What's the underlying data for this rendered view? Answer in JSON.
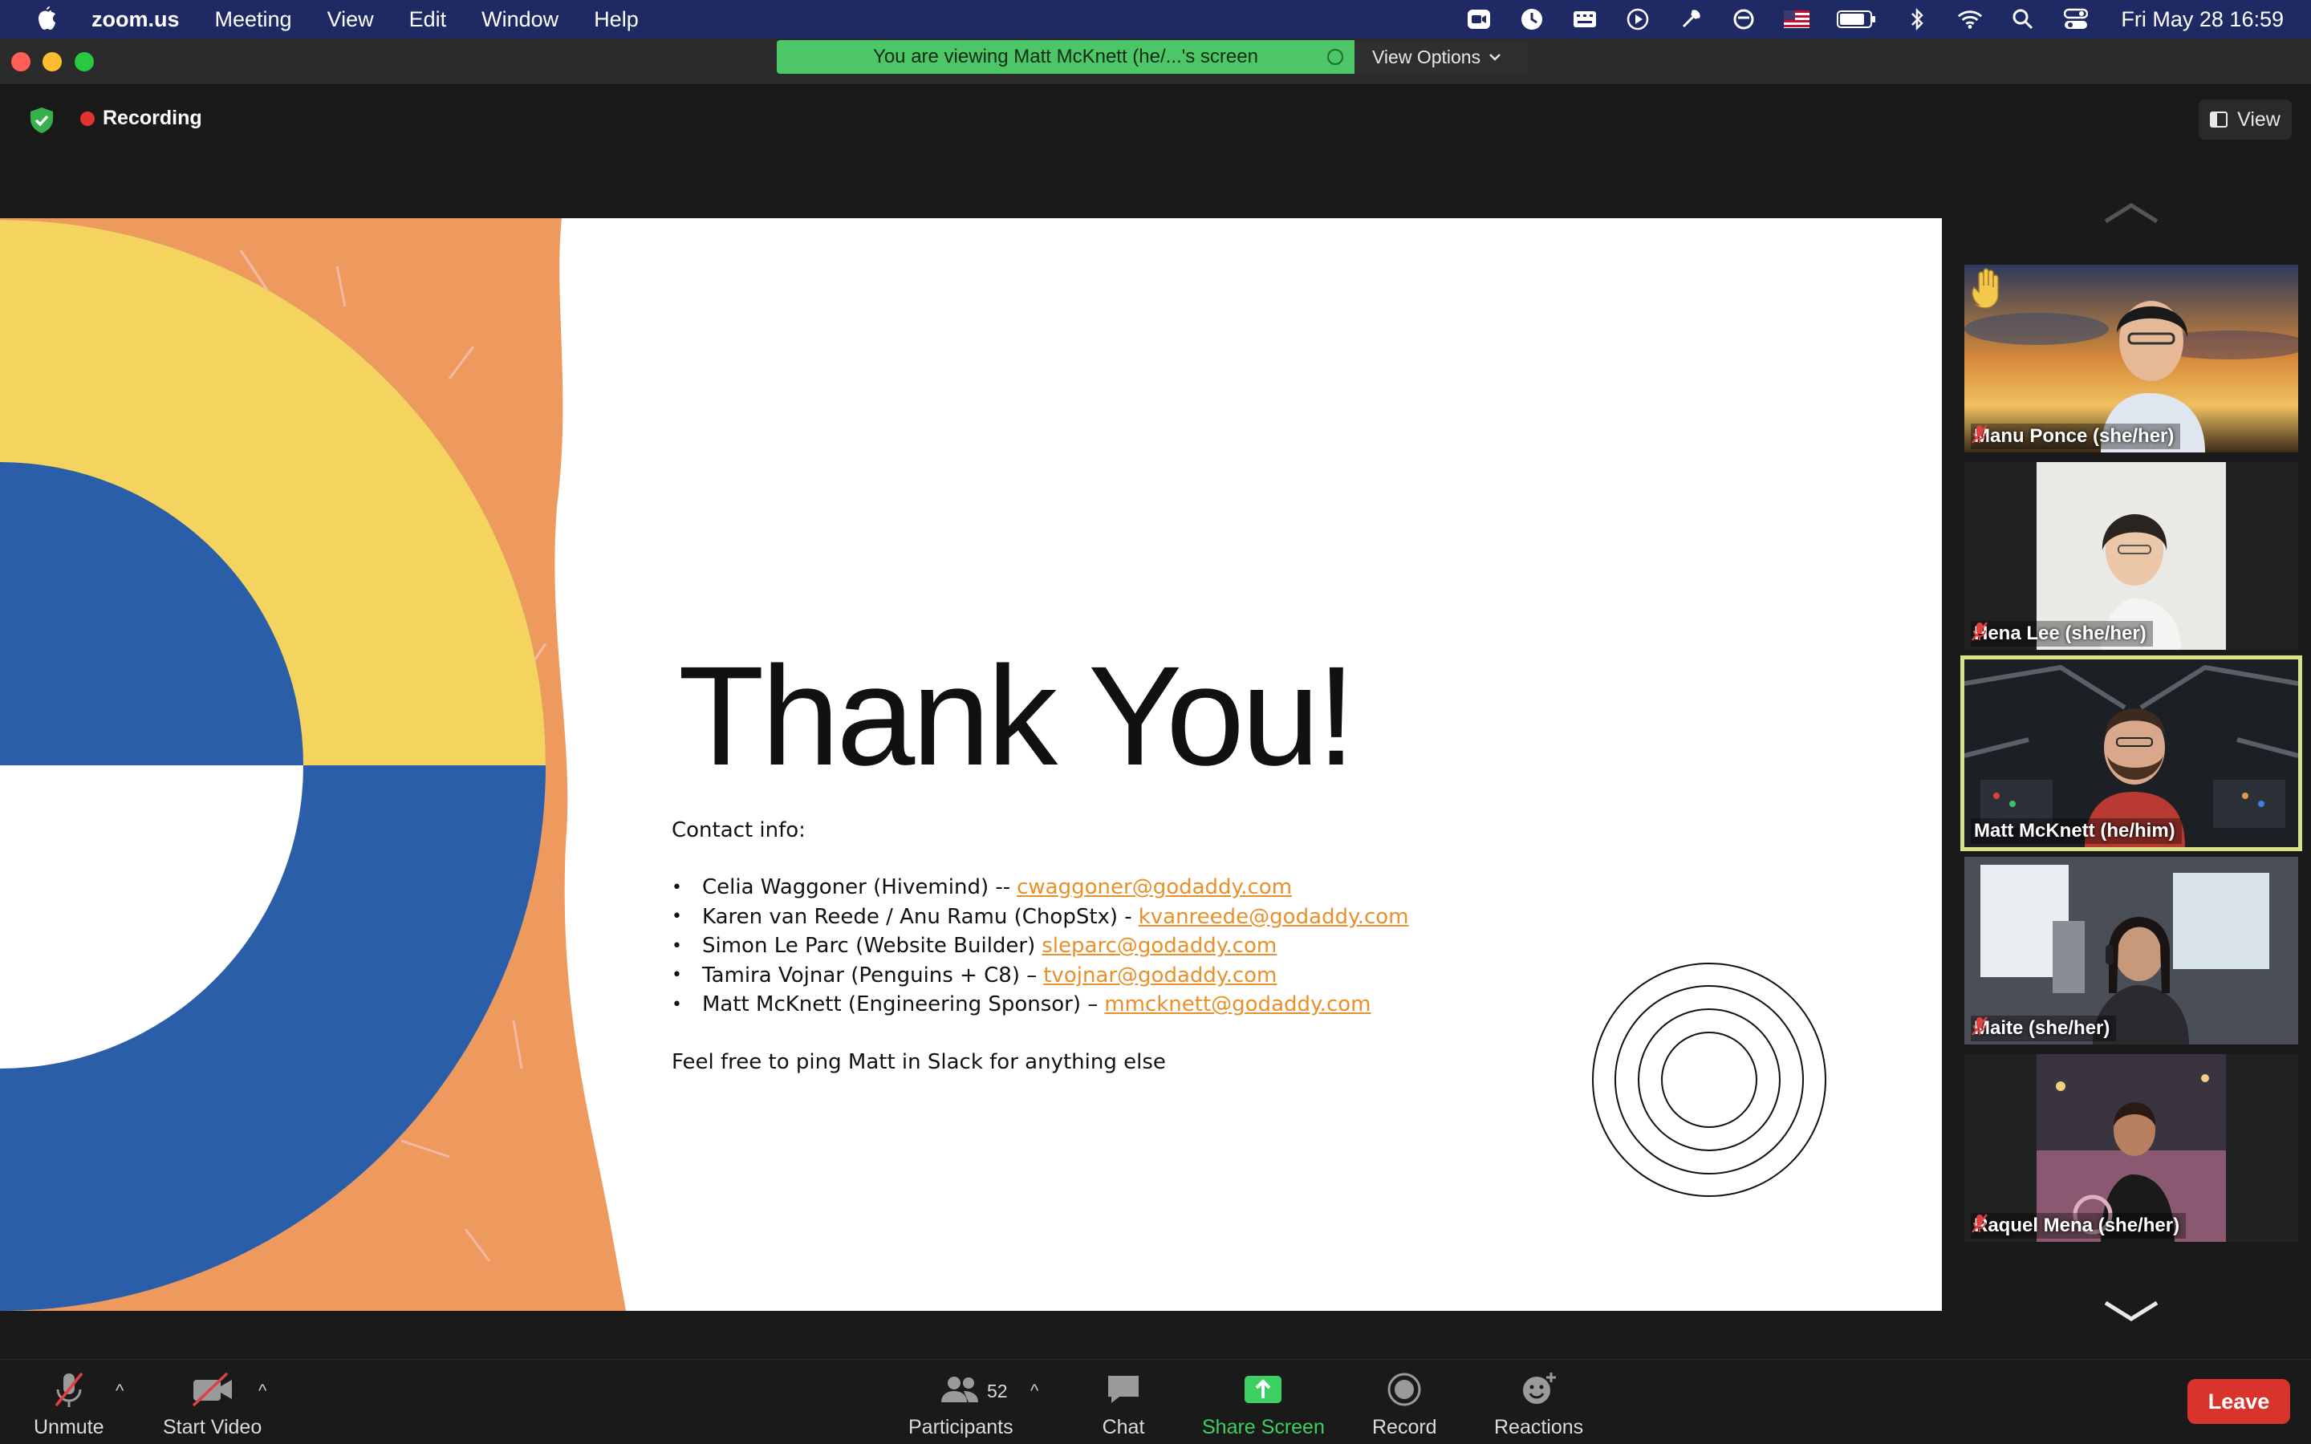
{
  "menubar": {
    "app": "zoom.us",
    "items": [
      "Meeting",
      "View",
      "Edit",
      "Window",
      "Help"
    ],
    "clock": "Fri May 28  16:59",
    "status_icons": [
      "zoom-icon",
      "clock-icon",
      "keyboard-icon",
      "play-icon",
      "tool-icon",
      "sync-icon",
      "flag-icon",
      "battery-icon",
      "bluetooth-icon",
      "wifi-icon",
      "search-icon",
      "control-center-icon"
    ]
  },
  "banner": {
    "viewing": "You are viewing Matt McKnett (he/...'s screen",
    "view_options": "View Options"
  },
  "meeting": {
    "recording": "Recording",
    "view_button": "View"
  },
  "slide": {
    "title": "Thank You!",
    "contact_label": "Contact info:",
    "contacts": [
      {
        "text": "Celia Waggoner (Hivemind) --",
        "email": "cwaggoner@godaddy.com"
      },
      {
        "text": "Karen van Reede / Anu Ramu (ChopStx) -",
        "email": "kvanreede@godaddy.com"
      },
      {
        "text": "Simon Le Parc (Website Builder)",
        "email": "sleparc@godaddy.com"
      },
      {
        "text": "Tamira Vojnar (Penguins + C8) –",
        "email": "tvojnar@godaddy.com"
      },
      {
        "text": "Matt McKnett (Engineering Sponsor) –",
        "email": "mmcknett@godaddy.com"
      }
    ],
    "footer": "Feel free to ping Matt in Slack for anything else",
    "colors": {
      "orange": "#ee9a5f",
      "yellow": "#f4d35e",
      "blue": "#2b5ea8",
      "link": "#e8902a"
    }
  },
  "participants": [
    {
      "name": "Manu Ponce (she/her)",
      "muted": true,
      "hand_raised": true
    },
    {
      "name": "Hena Lee (she/her)",
      "muted": true
    },
    {
      "name": "Matt McKnett (he/him)",
      "muted": false,
      "active_speaker": true
    },
    {
      "name": "Maite (she/her)",
      "muted": true
    },
    {
      "name": "Raquel Mena (she/her)",
      "muted": true
    }
  ],
  "controls": {
    "unmute": "Unmute",
    "start_video": "Start Video",
    "participants": "Participants",
    "participant_count": "52",
    "chat": "Chat",
    "share_screen": "Share Screen",
    "record": "Record",
    "reactions": "Reactions",
    "leave": "Leave"
  }
}
